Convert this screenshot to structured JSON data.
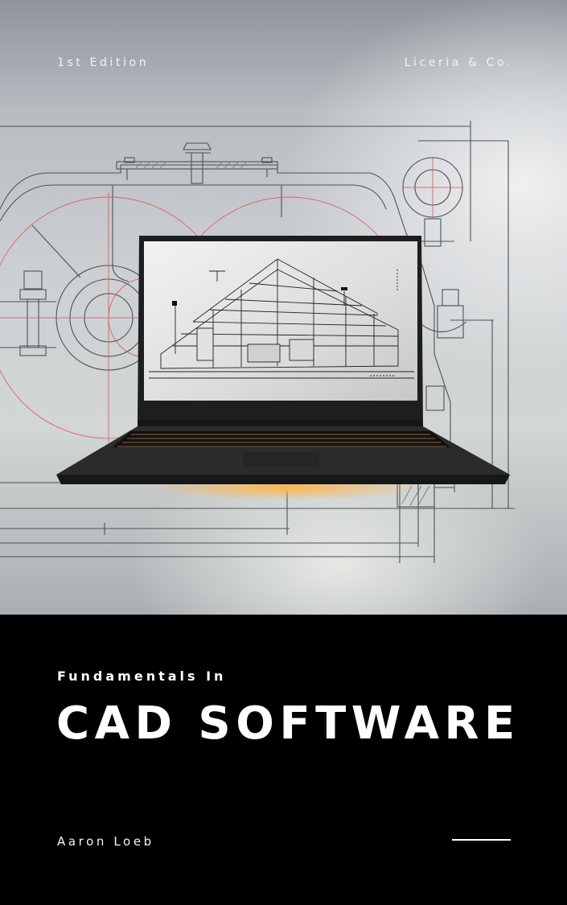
{
  "cover": {
    "edition": "1st Edition",
    "publisher": "Liceria & Co.",
    "subtitle": "Fundamentals In",
    "title": "CAD SOFTWARE",
    "author": "Aaron Loeb"
  },
  "illustration": {
    "background_icon": "mechanical-blueprint-icon",
    "device_icon": "laptop-icon",
    "screen_icon": "architectural-wireframe-icon"
  },
  "colors": {
    "title_band": "#000000",
    "text_light": "#ffffff",
    "blueprint_line": "#4d5258",
    "blueprint_red": "#e0474c",
    "laptop_body": "#202122",
    "keyboard_glow": "#e8a24a"
  }
}
